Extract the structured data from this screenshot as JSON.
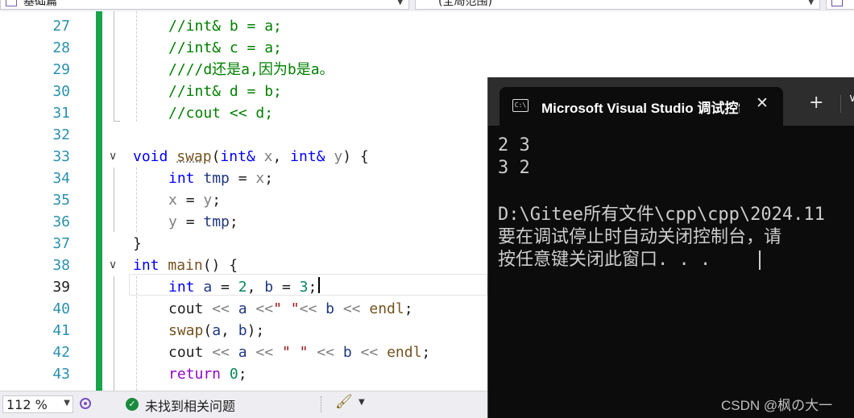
{
  "navbar": {
    "project_dropdown": "基础篇",
    "scope_dropdown": "(全局范围)"
  },
  "editor": {
    "line_numbers": [
      "27",
      "28",
      "29",
      "30",
      "31",
      "32",
      "33",
      "34",
      "35",
      "36",
      "37",
      "38",
      "39",
      "40",
      "41",
      "42",
      "43"
    ],
    "current_line": "39",
    "lines": {
      "l27": "//int& b = a;",
      "l28": "//int& c = a;",
      "l29": "////d还是a,因为b是a。",
      "l30": "//int& d = b;",
      "l31": "//cout << d;",
      "l33_kw": "void",
      "l33_fn": "swap",
      "l33_open": "(",
      "l33_t1": "int&",
      "l33_p1": "x",
      "l33_comma": ",",
      "l33_t2": "int&",
      "l33_p2": "y",
      "l33_close": ") {",
      "l34_kw": "int",
      "l34_var": "tmp",
      "l34_eq": "=",
      "l34_p": "x",
      "l34_end": ";",
      "l35_a": "x",
      "l35_eq": "=",
      "l35_b": "y",
      "l35_end": ";",
      "l36_a": "y",
      "l36_eq": "=",
      "l36_b": "tmp",
      "l36_end": ";",
      "l37": "}",
      "l38_kw": "int",
      "l38_fn": "main",
      "l38_rest": "() {",
      "l39_kw": "int",
      "l39_a": "a",
      "l39_eq1": "=",
      "l39_n1": "2",
      "l39_comma": ",",
      "l39_b": "b",
      "l39_eq2": "=",
      "l39_n2": "3",
      "l39_end": ";",
      "l40_cout": "cout",
      "l40_op1": "<<",
      "l40_a": "a",
      "l40_op2": "<<",
      "l40_str": "\" \"",
      "l40_op3": "<<",
      "l40_b": "b",
      "l40_op4": "<<",
      "l40_endl": "endl",
      "l40_end": ";",
      "l41_fn": "swap",
      "l41_open": "(",
      "l41_a": "a",
      "l41_comma": ",",
      "l41_b": "b",
      "l41_end": ");",
      "l42_cout": "cout",
      "l42_op1": "<<",
      "l42_a": "a",
      "l42_op2": "<<",
      "l42_str": "\" \"",
      "l42_op3": "<<",
      "l42_b": "b",
      "l42_op4": "<<",
      "l42_endl": "endl",
      "l42_end": ";",
      "l43_kw": "return",
      "l43_n": "0",
      "l43_end": ";"
    }
  },
  "statusbar": {
    "zoom": "112 %",
    "issues_text": "未找到相关问题"
  },
  "console": {
    "title": "Microsoft Visual Studio 调试控制台",
    "new_tab_icon": "plus-icon",
    "output_lines": [
      "2 3",
      "3 2",
      "",
      "D:\\Gitee所有文件\\cpp\\cpp\\2024.11",
      "要在调试停止时自动关闭控制台，请",
      "按任意键关闭此窗口. . ."
    ]
  },
  "watermark": "CSDN @枫の大一",
  "colors": {
    "keyword": "#0000ff",
    "comment": "#008000",
    "function": "#74531f",
    "change_bar": "#19a34a",
    "console_bg": "#0c0c0c",
    "console_text": "#cccccc"
  }
}
